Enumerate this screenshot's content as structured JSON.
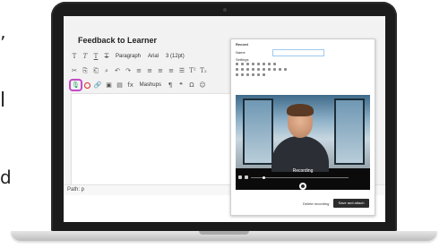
{
  "slide_edge": {
    "char_1": "’",
    "char_2": "l",
    "char_3": "d"
  },
  "editor": {
    "title": "Feedback to Learner",
    "toolbar_row1": {
      "t1": "T",
      "t2": "T",
      "t3": "T",
      "t4": "T",
      "format": "Paragraph",
      "font": "Arial",
      "size": "3 (12pt)"
    },
    "toolbar_row2": {
      "cut": "✂",
      "copy": "⎘",
      "paste": "⎗",
      "find": "⌕",
      "undo": "↶",
      "redo": "↷",
      "sup": "T²",
      "sub": "T₂"
    },
    "toolbar_row3": {
      "mashups": "Mashups",
      "pilcrow": "¶",
      "quote": "❝",
      "symbol": "Ω",
      "emoji": "☺",
      "fx": "fx"
    },
    "path": "Path: p"
  },
  "popup": {
    "title": "Record",
    "field_label": "Name",
    "settings_label": "Settings",
    "recording_caption": "Recording",
    "delete_label": "Delete recording",
    "save_label": "Save and attach"
  }
}
